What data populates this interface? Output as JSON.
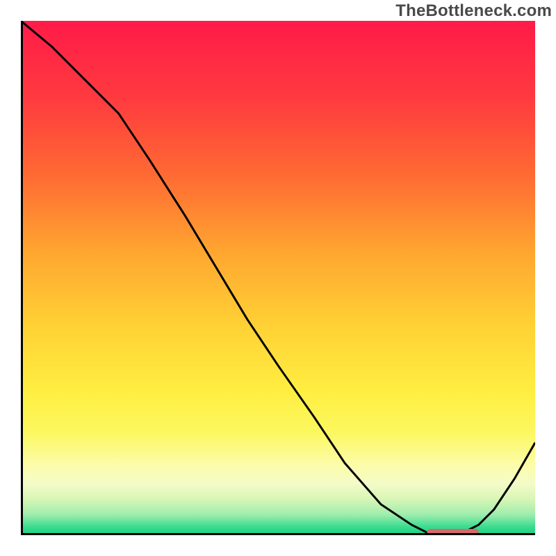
{
  "watermark": "TheBottleneck.com",
  "chart_data": {
    "type": "line",
    "title": "",
    "xlabel": "",
    "ylabel": "",
    "xlim": [
      0,
      100
    ],
    "ylim": [
      0,
      100
    ],
    "grid": false,
    "series": [
      {
        "name": "curve",
        "x": [
          0,
          6,
          12,
          19,
          25,
          32,
          38,
          44,
          50,
          57,
          63,
          70,
          76,
          80,
          85,
          89,
          92,
          96,
          100
        ],
        "y": [
          100,
          95,
          89,
          82,
          73,
          62,
          52,
          42,
          33,
          23,
          14,
          6,
          2,
          0,
          0,
          2,
          5,
          11,
          18
        ]
      }
    ],
    "marker": {
      "name": "optimal-zone",
      "x_start": 79,
      "x_end": 89,
      "y": 0,
      "color": "#d66a6a"
    },
    "background_gradient": {
      "stops": [
        {
          "pos": 0.0,
          "color": "#ff1b48"
        },
        {
          "pos": 0.15,
          "color": "#ff3a3f"
        },
        {
          "pos": 0.3,
          "color": "#ff6a33"
        },
        {
          "pos": 0.45,
          "color": "#ffa630"
        },
        {
          "pos": 0.6,
          "color": "#ffd335"
        },
        {
          "pos": 0.72,
          "color": "#ffee41"
        },
        {
          "pos": 0.8,
          "color": "#fbf85f"
        },
        {
          "pos": 0.86,
          "color": "#fdfca6"
        },
        {
          "pos": 0.9,
          "color": "#f4fbc8"
        },
        {
          "pos": 0.93,
          "color": "#d7f6b6"
        },
        {
          "pos": 0.96,
          "color": "#9fedad"
        },
        {
          "pos": 0.985,
          "color": "#37db8f"
        },
        {
          "pos": 1.0,
          "color": "#18d084"
        }
      ]
    },
    "axis_color": "#000000",
    "line_color": "#000000",
    "line_width": 3
  }
}
